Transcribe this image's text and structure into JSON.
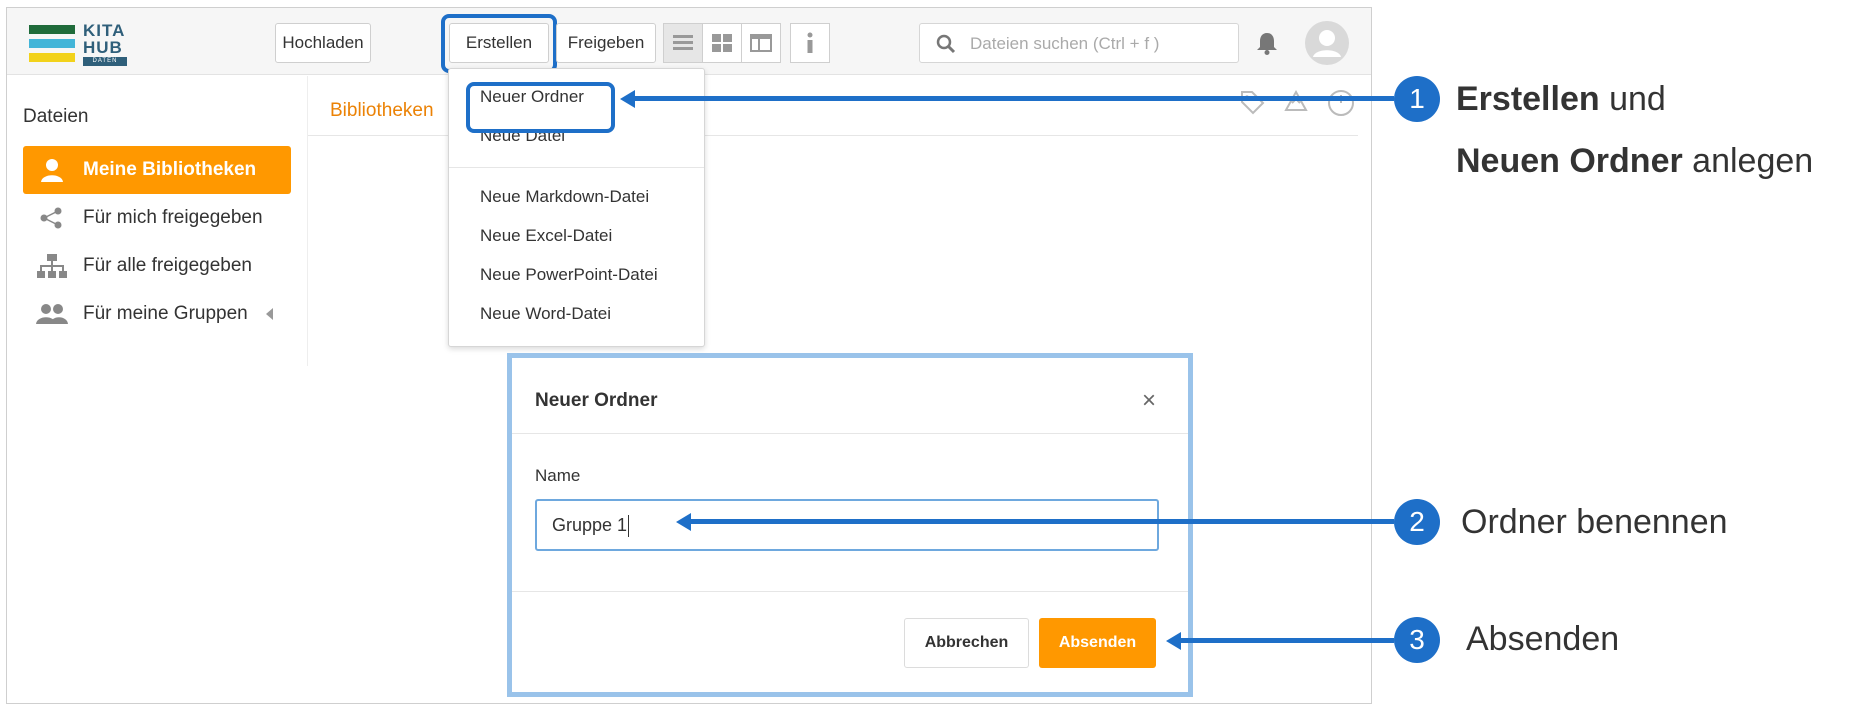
{
  "logo": {
    "line1": "KITA",
    "line2": "HUB",
    "line3": "DATEN"
  },
  "toolbar": {
    "upload_label": "Hochladen",
    "create_label": "Erstellen",
    "share_label": "Freigeben"
  },
  "search": {
    "placeholder": "Dateien suchen (Ctrl + f )"
  },
  "sidebar": {
    "title": "Dateien",
    "items": [
      {
        "label": "Meine Bibliotheken",
        "icon": "user-icon"
      },
      {
        "label": "Für mich freigegeben",
        "icon": "share-icon"
      },
      {
        "label": "Für alle freigegeben",
        "icon": "org-tree-icon"
      },
      {
        "label": "Für meine Gruppen",
        "icon": "group-icon"
      }
    ]
  },
  "main": {
    "breadcrumb": "Bibliotheken"
  },
  "dropdown": {
    "items": [
      "Neuer Ordner",
      "Neue Datei",
      "Neue Markdown-Datei",
      "Neue Excel-Datei",
      "Neue PowerPoint-Datei",
      "Neue Word-Datei"
    ]
  },
  "modal": {
    "title": "Neuer Ordner",
    "close": "×",
    "name_label": "Name",
    "name_value": "Gruppe 1",
    "cancel_label": "Abbrechen",
    "submit_label": "Absenden"
  },
  "annotations": [
    {
      "number": "1",
      "bold1": "Erstellen",
      "text1": " und",
      "bold2": "Neuen Ordner",
      "text2": " anlegen"
    },
    {
      "number": "2",
      "text": "Ordner benennen"
    },
    {
      "number": "3",
      "text": "Absenden"
    }
  ],
  "colors": {
    "accent": "#ff9800",
    "annotation": "#1e6fc8",
    "breadcrumb": "#eb8205"
  }
}
